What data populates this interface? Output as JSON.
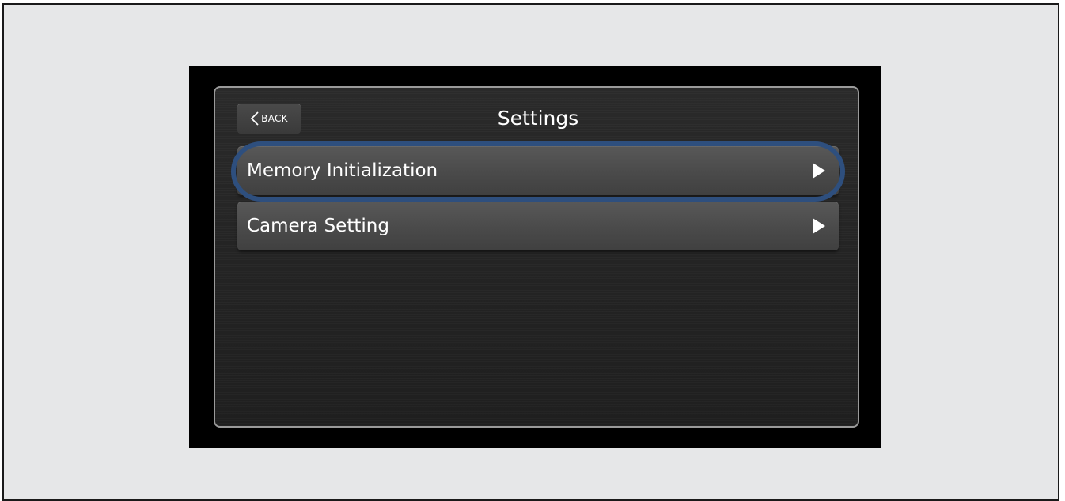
{
  "screen": {
    "title": "Settings",
    "back_label": "BACK"
  },
  "menu": {
    "items": [
      {
        "label": "Memory Initialization",
        "icon": "play-arrow-icon",
        "highlighted": true
      },
      {
        "label": "Camera Setting",
        "icon": "play-arrow-icon",
        "highlighted": false
      }
    ]
  },
  "colors": {
    "page_background": "#e6e7e8",
    "bezel": "#000000",
    "highlight_ring": "#2e4f7e",
    "row_background": "#4a4a4a",
    "text": "#ffffff"
  }
}
